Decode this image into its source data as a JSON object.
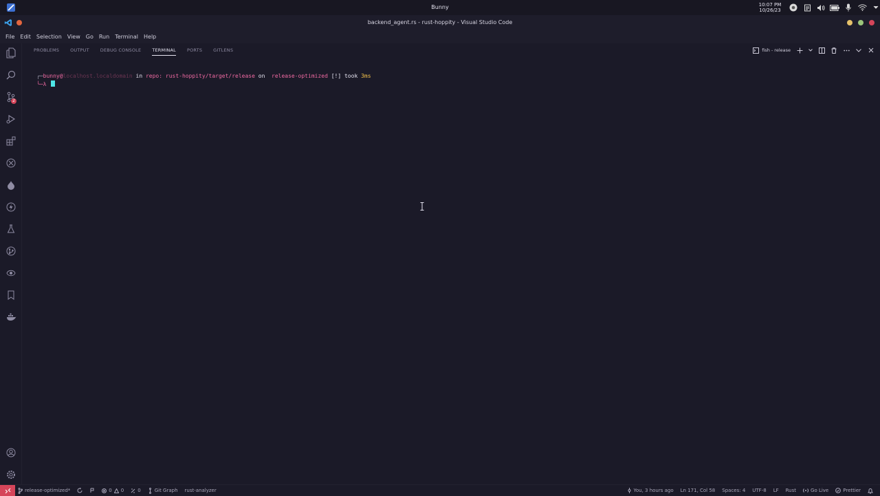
{
  "system": {
    "title": "Bunny",
    "time": "10:07 PM",
    "date": "10/26/23"
  },
  "window": {
    "title": "backend_agent.rs - rust-hoppity - Visual Studio Code"
  },
  "menu": {
    "items": [
      "File",
      "Edit",
      "Selection",
      "View",
      "Go",
      "Run",
      "Terminal",
      "Help"
    ]
  },
  "activity": {
    "source_control_badge": "2"
  },
  "panel": {
    "tabs": [
      "PROBLEMS",
      "OUTPUT",
      "DEBUG CONSOLE",
      "TERMINAL",
      "PORTS",
      "GITLENS"
    ],
    "active_tab": "TERMINAL",
    "terminal_name": "fish - release"
  },
  "terminal": {
    "corner_top": "╭─",
    "user": "bunny",
    "at": "@",
    "host": "localhost.localdomain",
    "in": " in ",
    "repo_label": "repo: ",
    "path": "rust-hoppity/target/release",
    "on": " on ",
    "branch_icon": "",
    "branch": " release-optimized",
    "status": " [!]",
    "took": " took ",
    "duration": "3ms",
    "corner_bottom": "╰─λ "
  },
  "status": {
    "branch": "release-optimized*",
    "errors": "0",
    "warnings": "0",
    "ports": "0",
    "git_graph": "Git Graph",
    "rust_analyzer": "rust-analyzer",
    "blame": "You, 3 hours ago",
    "position": "Ln 171, Col 58",
    "spaces": "Spaces: 4",
    "encoding": "UTF-8",
    "eol": "LF",
    "language": "Rust",
    "go_live": "Go Live",
    "prettier": "Prettier"
  },
  "colors": {
    "accent": "#d6455a",
    "prompt_pink": "#f06aa2",
    "cursor": "#4ee6e6",
    "took": "#f3c04a"
  }
}
